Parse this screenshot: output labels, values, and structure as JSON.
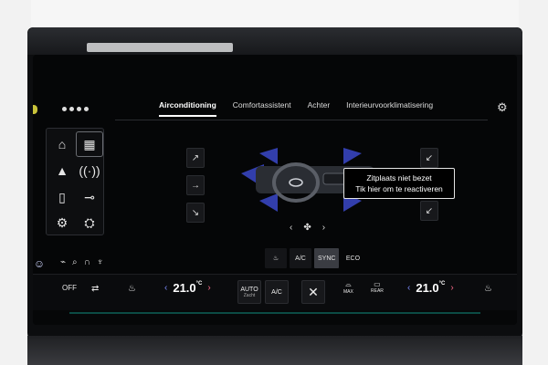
{
  "tabs": [
    {
      "label": "Airconditioning",
      "active": true
    },
    {
      "label": "Comfortassistent",
      "active": false
    },
    {
      "label": "Achter",
      "active": false
    },
    {
      "label": "Interieurvoorklimatisering",
      "active": false
    }
  ],
  "tooltip": {
    "line1": "Zitplaats niet bezet",
    "line2": "Tik hier om te reactiveren"
  },
  "modes": {
    "ac": "A/C",
    "sync": "SYNC",
    "eco": "ECO"
  },
  "bottom": {
    "off": "OFF",
    "left_temp": "21.0",
    "right_temp": "21.0",
    "unit": "°C",
    "auto": "AUTO",
    "auto_sub": "Zacht",
    "ac": "A/C",
    "max": "MAX",
    "rear": "REAR"
  },
  "icons": {
    "home": "home-icon",
    "apps": "grid-icon",
    "nav": "navigation-icon",
    "radio": "radio-icon",
    "phone": "phone-icon",
    "car": "car-icon",
    "settings": "gear-icon"
  },
  "colors": {
    "left_chevron": "#7d8cff",
    "right_chevron": "#ff6b8b",
    "accent": "#0f7a6c"
  }
}
